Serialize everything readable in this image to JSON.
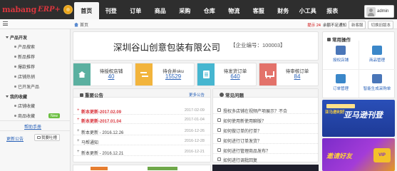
{
  "app": {
    "logo_brand": "mabang",
    "logo_suffix": "ERP+"
  },
  "nav": [
    "首页",
    "刊登",
    "订单",
    "商品",
    "采购",
    "仓库",
    "物流",
    "客服",
    "财务",
    "小工具",
    "报表"
  ],
  "user": {
    "name": "admin"
  },
  "toolbar": {
    "breadcrumb": "首页",
    "links": [
      "提示 24",
      "余额不足通知"
    ],
    "buttons": [
      "新客服",
      "切换旧版本"
    ]
  },
  "sidebar": {
    "sections": [
      {
        "title": "产品开发",
        "items": [
          "产品搜索",
          "新品推荐",
          "爆款推荐",
          "店铺热销",
          "已开发产品"
        ]
      },
      {
        "title": "我的收藏",
        "items": [
          "店铺收藏",
          "商品收藏"
        ]
      }
    ],
    "new_tag": "New",
    "help": "帮助手册",
    "notice": "更新公告",
    "feedback": "我要吐槽"
  },
  "company": {
    "name": "深圳谷山创意包装有限公司",
    "code_label": "【企业编号：100003】"
  },
  "stats": [
    {
      "label": "待授权店铺",
      "value": "40",
      "color": "#5bb0a0",
      "icon": "store-icon"
    },
    {
      "label": "待合并sku",
      "value": "15529",
      "color": "#f2b43c",
      "icon": "merge-icon"
    },
    {
      "label": "待发货订单",
      "value": "640",
      "color": "#46b6d0",
      "icon": "order-icon"
    },
    {
      "label": "待审核订单",
      "value": "84",
      "color": "#e3726a",
      "icon": "cart-icon"
    }
  ],
  "announcements": {
    "title": "重要公告",
    "more": "更多公告",
    "items": [
      {
        "title": "新本更新-2017.02.09",
        "date": "2017-02-09",
        "hot": true
      },
      {
        "title": "新本更新-2017.01.04",
        "date": "2017-01-04",
        "hot": true
      },
      {
        "title": "新本更新 - 2016.12.26",
        "date": "2016-12-26",
        "hot": false
      },
      {
        "title": "马帮通知",
        "date": "2016-12-28",
        "hot": false
      },
      {
        "title": "新本更新 - 2016.12.21",
        "date": "2016-12-21",
        "hot": false
      }
    ]
  },
  "faq": {
    "title": "常见问题",
    "items": [
      "授权多店铺在视频产项展示？不合",
      "如何使用新使用聊版？",
      "如何做订单的打单？",
      "如何进行订单发货？",
      "如何进行管理商品发布？",
      "如何进行调批回复"
    ]
  },
  "quick": {
    "title": "常用操作",
    "items": [
      "授权店铺",
      "商品管理",
      "订单管理",
      "智能生成采购单"
    ]
  },
  "ads": {
    "ad1_small": "亚马逊利好",
    "ad1_big": "亚马逊刊登",
    "ad2_text": "邀请好友",
    "ad2_vip": "VIP"
  }
}
